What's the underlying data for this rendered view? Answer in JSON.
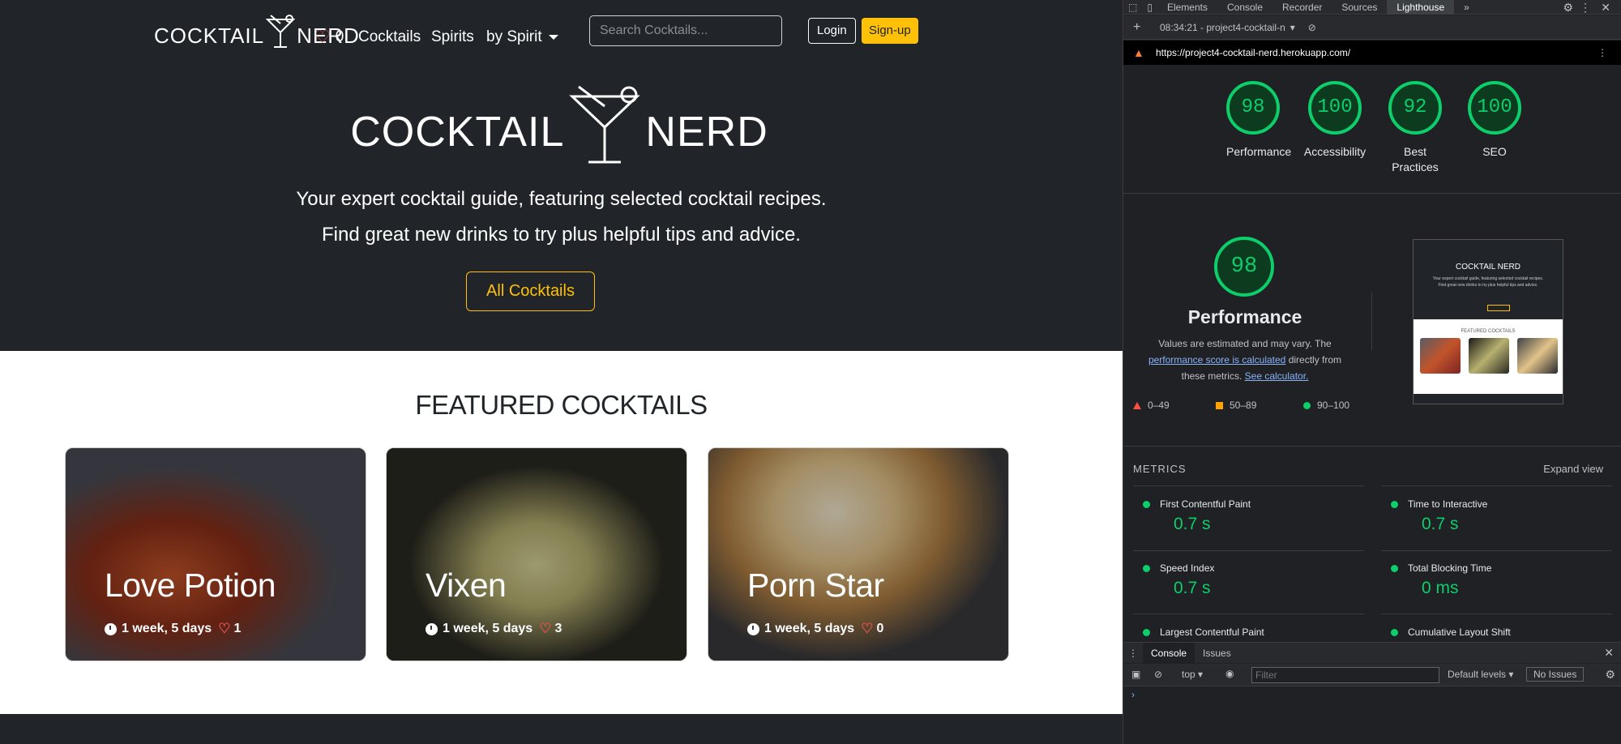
{
  "site": {
    "brand_left": "COCKTAIL",
    "brand_right": "NERD",
    "likes_count": "0",
    "nav": {
      "cocktails": "Cocktails",
      "spirits": "Spirits",
      "by_spirit": "by Spirit"
    },
    "search_placeholder": "Search Cocktails...",
    "login": "Login",
    "signup": "Sign-up",
    "hero": {
      "logo_left": "COCKTAIL",
      "logo_right": "NERD",
      "line1": "Your expert cocktail guide, featuring selected cocktail recipes.",
      "line2": "Find great new drinks to try plus helpful tips and advice.",
      "button": "All Cocktails"
    },
    "featured_title": "FEATURED COCKTAILS",
    "cards": [
      {
        "title": "Love Potion",
        "age": "1 week, 5 days",
        "likes": "1"
      },
      {
        "title": "Vixen",
        "age": "1 week, 5 days",
        "likes": "3"
      },
      {
        "title": "Porn Star",
        "age": "1 week, 5 days",
        "likes": "0"
      }
    ]
  },
  "devtools": {
    "tabs": [
      "Elements",
      "Console",
      "Recorder",
      "Sources",
      "Lighthouse"
    ],
    "active_tab": "Lighthouse",
    "report_label": "08:34:21 - project4-cocktail-n",
    "url": "https://project4-cocktail-nerd.herokuapp.com/",
    "scores": [
      {
        "value": "98",
        "label": "Performance"
      },
      {
        "value": "100",
        "label": "Accessibility"
      },
      {
        "value": "92",
        "label": "Best Practices"
      },
      {
        "value": "100",
        "label": "SEO"
      }
    ],
    "performance": {
      "score": "98",
      "title": "Performance",
      "note_a": "Values are estimated and may vary. The",
      "note_link": "performance score is calculated",
      "note_b": "directly from these metrics.",
      "note_calc": "See calculator."
    },
    "legend": [
      "0–49",
      "50–89",
      "90–100"
    ],
    "thumb": {
      "title": "COCKTAIL NERD",
      "featured": "FEATURED COCKTAILS"
    },
    "metrics_header": "METRICS",
    "expand_view": "Expand view",
    "metrics": [
      {
        "name": "First Contentful Paint",
        "value": "0.7 s"
      },
      {
        "name": "Time to Interactive",
        "value": "0.7 s"
      },
      {
        "name": "Speed Index",
        "value": "0.7 s"
      },
      {
        "name": "Total Blocking Time",
        "value": "0 ms"
      },
      {
        "name": "Largest Contentful Paint",
        "value": ""
      },
      {
        "name": "Cumulative Layout Shift",
        "value": ""
      }
    ],
    "console": {
      "tabs": [
        "Console",
        "Issues"
      ],
      "context": "top",
      "filter_placeholder": "Filter",
      "levels": "Default levels",
      "issues": "No Issues",
      "prompt": "›"
    },
    "colors": {
      "pass": "#0cce6b",
      "average": "#ffa400",
      "fail": "#ff4e42"
    }
  }
}
